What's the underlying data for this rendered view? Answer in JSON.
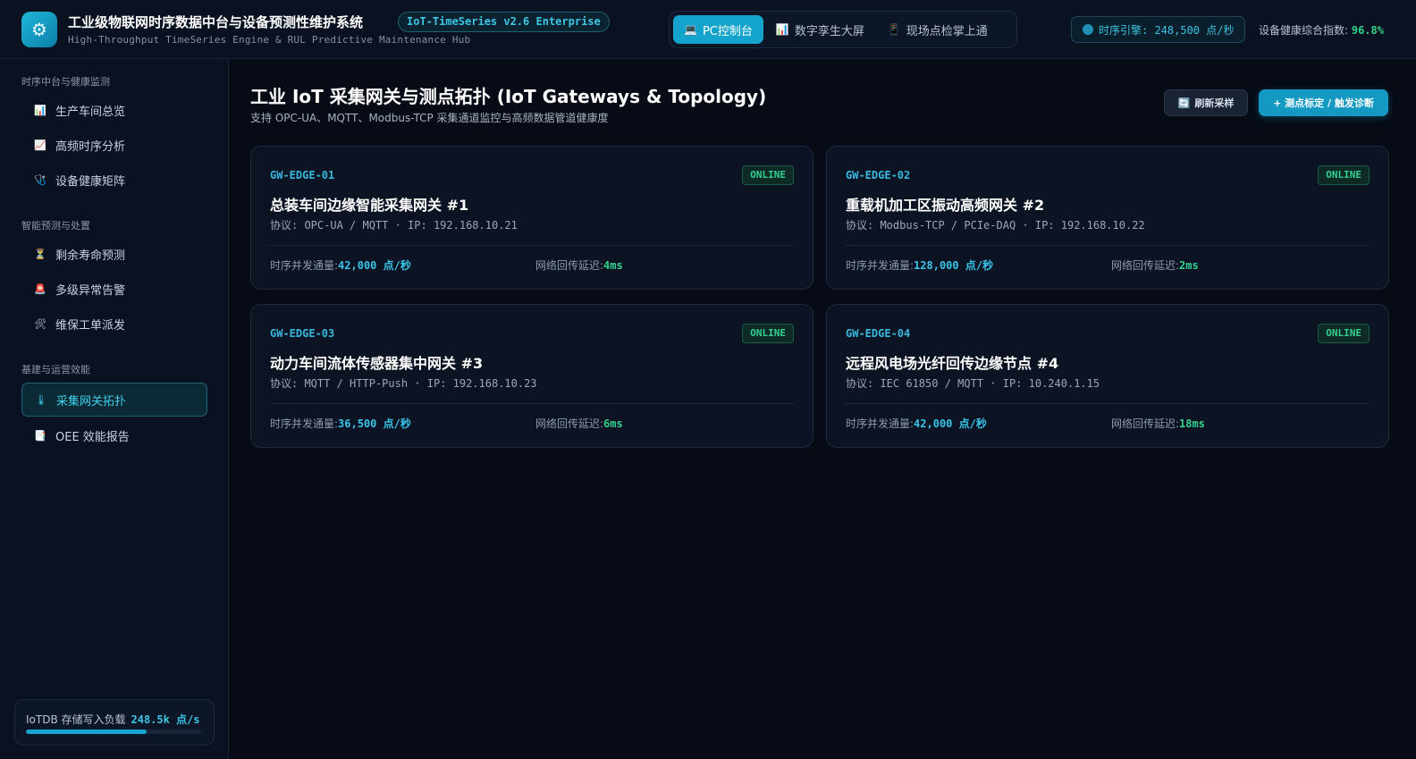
{
  "header": {
    "logo_icon": "gear-icon",
    "title": "工业级物联网时序数据中台与设备预测性维护系统",
    "version": "IoT-TimeSeries v2.6 Enterprise",
    "subtitle": "High-Throughput TimeSeries Engine & RUL Predictive Maintenance Hub",
    "view_tabs": [
      {
        "icon": "💻",
        "label": "PC控制台",
        "active": true
      },
      {
        "icon": "📊",
        "label": "数字孪生大屏",
        "active": false
      },
      {
        "icon": "📱",
        "label": "现场点检掌上通",
        "active": false
      }
    ],
    "engine_rate": "时序引擎: 248,500 点/秒",
    "health_label": "设备健康综合指数: ",
    "health_value": "96.8%"
  },
  "sidebar": {
    "sections": [
      {
        "title": "时序中台与健康监测",
        "items": [
          {
            "icon": "📊",
            "label": "生产车间总览"
          },
          {
            "icon": "📈",
            "label": "高频时序分析"
          },
          {
            "icon": "🩺",
            "label": "设备健康矩阵"
          }
        ]
      },
      {
        "title": "智能预测与处置",
        "items": [
          {
            "icon": "⏳",
            "label": "剩余寿命预测"
          },
          {
            "icon": "🚨",
            "label": "多级异常告警"
          },
          {
            "icon": "🛠",
            "label": "维保工单派发"
          }
        ]
      },
      {
        "title": "基建与运营效能",
        "items": [
          {
            "icon": "🌡",
            "label": "采集网关拓扑",
            "active": true
          },
          {
            "icon": "📑",
            "label": "OEE 效能报告"
          }
        ]
      }
    ],
    "storage": {
      "label": "IoTDB 存储写入负载",
      "value": "248.5k 点/s",
      "load_fraction": 0.69
    }
  },
  "main": {
    "title": "工业 IoT 采集网关与测点拓扑 (IoT Gateways & Topology)",
    "subtitle": "支持 OPC-UA、MQTT、Modbus-TCP 采集通道监控与高频数据管道健康度",
    "refresh_icon": "🔄",
    "refresh_label": "刷新采样",
    "calibrate_label": "+ 测点标定 / 触发诊断",
    "throughput_label": "时序并发通量:",
    "latency_label": "网络回传延迟:",
    "gateways": [
      {
        "id": "GW-EDGE-01",
        "status": "ONLINE",
        "name": "总装车间边缘智能采集网关 #1",
        "protocol": "协议: OPC-UA / MQTT · IP: 192.168.10.21",
        "throughput": "42,000 点/秒",
        "latency": "4ms"
      },
      {
        "id": "GW-EDGE-02",
        "status": "ONLINE",
        "name": "重载机加工区振动高频网关 #2",
        "protocol": "协议: Modbus-TCP / PCIe-DAQ · IP: 192.168.10.22",
        "throughput": "128,000 点/秒",
        "latency": "2ms"
      },
      {
        "id": "GW-EDGE-03",
        "status": "ONLINE",
        "name": "动力车间流体传感器集中网关 #3",
        "protocol": "协议: MQTT / HTTP-Push · IP: 192.168.10.23",
        "throughput": "36,500 点/秒",
        "latency": "6ms"
      },
      {
        "id": "GW-EDGE-04",
        "status": "ONLINE",
        "name": "远程风电场光纤回传边缘节点 #4",
        "protocol": "协议: IEC 61850 / MQTT · IP: 10.240.1.15",
        "throughput": "42,000 点/秒",
        "latency": "18ms"
      }
    ]
  }
}
